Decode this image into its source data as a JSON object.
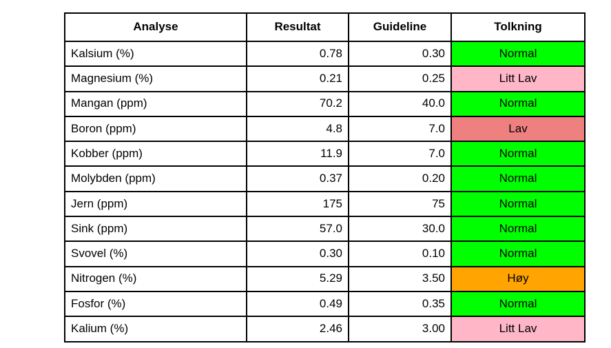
{
  "table": {
    "title": "Analyse",
    "columns": [
      {
        "key": "analyse",
        "label": "Analyse",
        "align": "left"
      },
      {
        "key": "resultat",
        "label": "Resultat",
        "align": "right"
      },
      {
        "key": "guideline",
        "label": "Guideline",
        "align": "right"
      },
      {
        "key": "tolkning",
        "label": "Tolkning",
        "align": "center"
      }
    ],
    "status_colors": {
      "Normal": "#00ff00",
      "Litt Lav": "#ffb6c6",
      "Lav": "#ef8080",
      "Høy": "#ffa400"
    },
    "rows": [
      {
        "analyse": "Kalsium (%)",
        "resultat": "0.78",
        "guideline": "0.30",
        "tolkning": "Normal",
        "status": "normal"
      },
      {
        "analyse": "Magnesium (%)",
        "resultat": "0.21",
        "guideline": "0.25",
        "tolkning": "Litt Lav",
        "status": "littlav"
      },
      {
        "analyse": "Mangan (ppm)",
        "resultat": "70.2",
        "guideline": "40.0",
        "tolkning": "Normal",
        "status": "normal"
      },
      {
        "analyse": "Boron (ppm)",
        "resultat": "4.8",
        "guideline": "7.0",
        "tolkning": "Lav",
        "status": "lav"
      },
      {
        "analyse": "Kobber (ppm)",
        "resultat": "11.9",
        "guideline": "7.0",
        "tolkning": "Normal",
        "status": "normal"
      },
      {
        "analyse": "Molybden (ppm)",
        "resultat": "0.37",
        "guideline": "0.20",
        "tolkning": "Normal",
        "status": "normal"
      },
      {
        "analyse": "Jern (ppm)",
        "resultat": "175",
        "guideline": "75",
        "tolkning": "Normal",
        "status": "normal"
      },
      {
        "analyse": "Sink (ppm)",
        "resultat": "57.0",
        "guideline": "30.0",
        "tolkning": "Normal",
        "status": "normal"
      },
      {
        "analyse": "Svovel (%)",
        "resultat": "0.30",
        "guideline": "0.10",
        "tolkning": "Normal",
        "status": "normal"
      },
      {
        "analyse": "Nitrogen (%)",
        "resultat": "5.29",
        "guideline": "3.50",
        "tolkning": "Høy",
        "status": "hoy"
      },
      {
        "analyse": "Fosfor (%)",
        "resultat": "0.49",
        "guideline": "0.35",
        "tolkning": "Normal",
        "status": "normal"
      },
      {
        "analyse": "Kalium (%)",
        "resultat": "2.46",
        "guideline": "3.00",
        "tolkning": "Litt Lav",
        "status": "littlav"
      }
    ]
  }
}
